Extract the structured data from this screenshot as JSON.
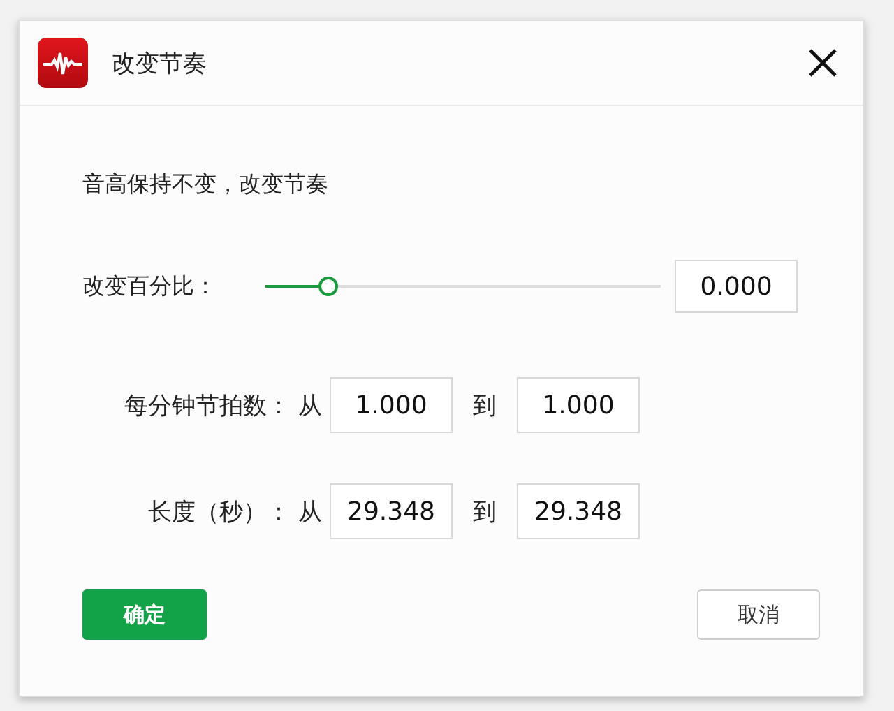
{
  "window": {
    "title": "改变节奏"
  },
  "description": "音高保持不变，改变节奏",
  "percent": {
    "label": "改变百分比：",
    "level": 0.16,
    "value": "0.000"
  },
  "ranges": [
    {
      "label": "每分钟节拍数：",
      "from_label": "从",
      "from": "1.000",
      "to_label": "到",
      "to": "1.000"
    },
    {
      "label": "长度（秒）：",
      "from_label": "从",
      "from": "29.348",
      "to_label": "到",
      "to": "29.348"
    }
  ],
  "buttons": [
    {
      "label": "确定",
      "kind": "primary"
    },
    {
      "label": "取消",
      "kind": "secondary"
    }
  ]
}
